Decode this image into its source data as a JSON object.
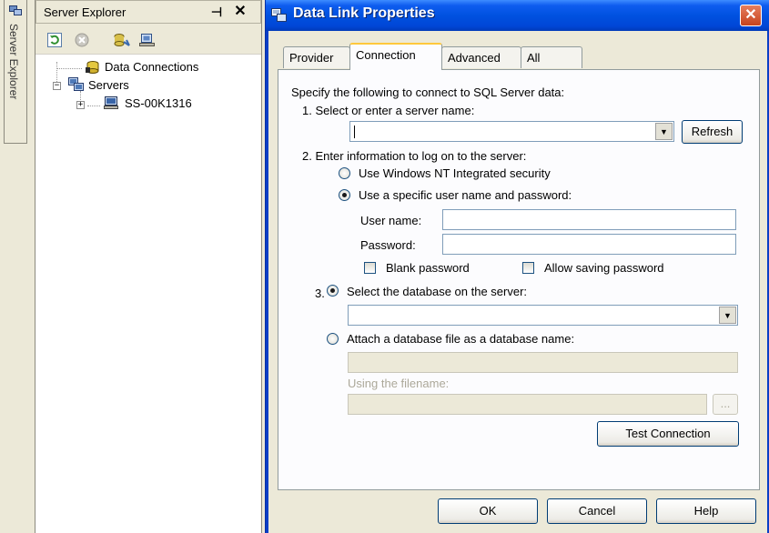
{
  "side_strip": {
    "tab_label": "Server Explorer"
  },
  "server_explorer": {
    "title": "Server Explorer",
    "pin_glyph": "⊣",
    "close_glyph": "✕",
    "tree": [
      {
        "label": "Data Connections",
        "expander": "",
        "icon": "database-icon"
      },
      {
        "label": "Servers",
        "expander": "−",
        "icon": "servers-icon"
      },
      {
        "label": "SS-00K1316",
        "expander": "+",
        "icon": "computer-icon"
      }
    ]
  },
  "dialog": {
    "title": "Data Link Properties",
    "close_glyph": "✕",
    "tabs": [
      "Provider",
      "Connection",
      "Advanced",
      "All"
    ],
    "active_tab": "Connection",
    "intro": "Specify the following to connect to SQL Server data:",
    "step1": {
      "label": "1. Select or enter a server name:",
      "value": "",
      "refresh_label": "Refresh"
    },
    "step2": {
      "label": "2. Enter information to log on to the server:",
      "option_nt": "Use Windows NT Integrated security",
      "option_specific": "Use a specific user name and password:",
      "selected": "specific",
      "username_label": "User name:",
      "username_value": "",
      "password_label": "Password:",
      "password_value": "",
      "blank_password": "Blank password",
      "allow_saving": "Allow saving password"
    },
    "step3": {
      "number": "3.",
      "option_select": "Select the database on the server:",
      "option_attach": "Attach a database file as a database name:",
      "selected": "select",
      "database_value": "",
      "attach_value": "",
      "filename_label": "Using the filename:",
      "filename_value": "",
      "browse_label": "..."
    },
    "test_connection_label": "Test Connection",
    "buttons": {
      "ok": "OK",
      "cancel": "Cancel",
      "help": "Help"
    },
    "colors": {
      "titlebar": "#0052e0",
      "body": "#ece9d8",
      "close": "#c8431d"
    }
  }
}
